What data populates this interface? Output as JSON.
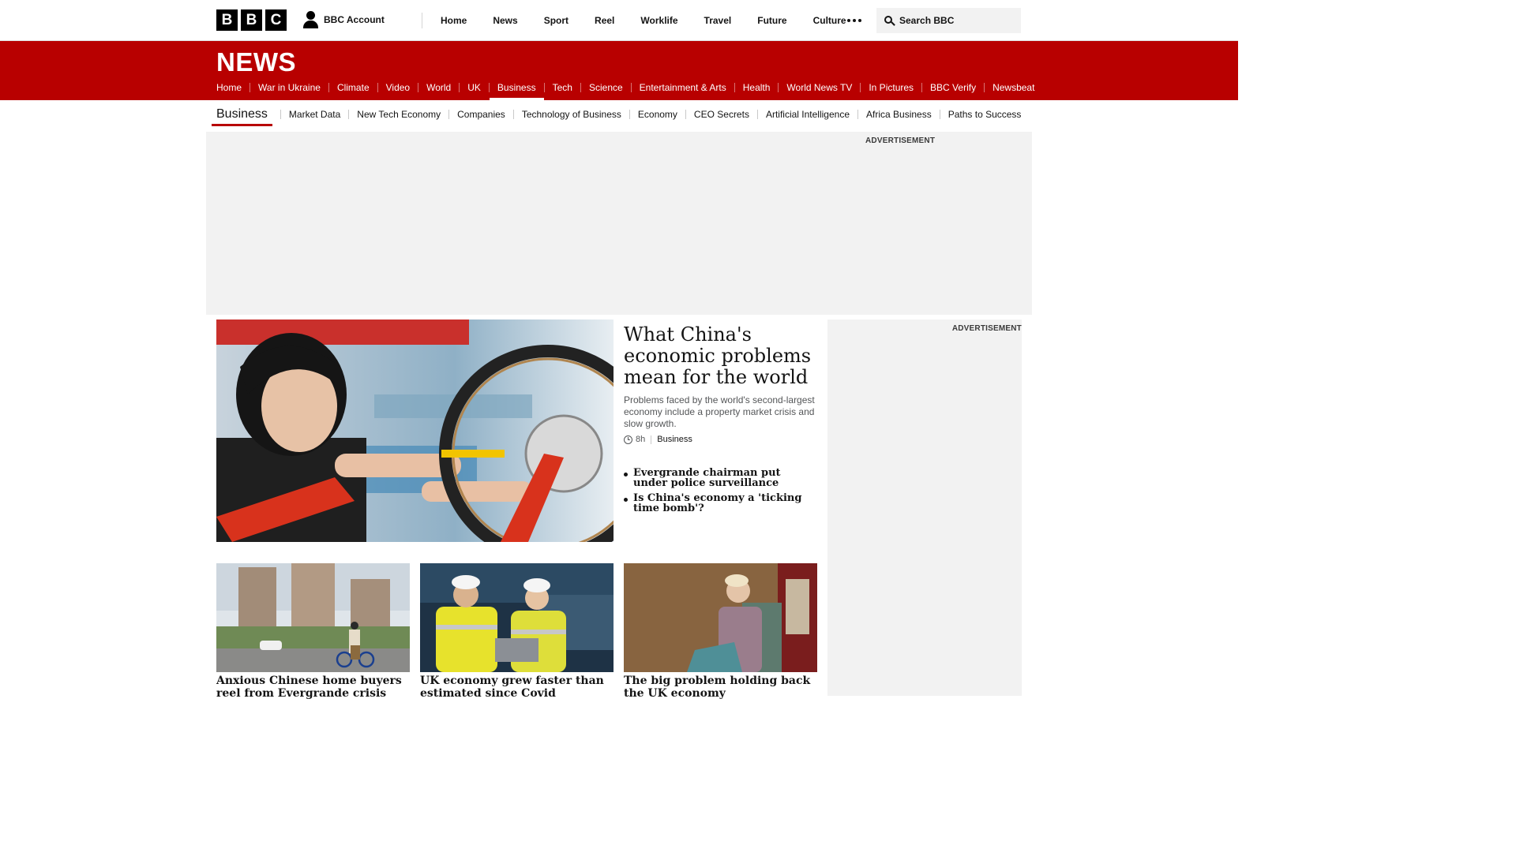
{
  "brand": {
    "letters": [
      "B",
      "B",
      "C"
    ]
  },
  "account": {
    "label": "BBC Account"
  },
  "top_nav": {
    "items": [
      "Home",
      "News",
      "Sport",
      "Reel",
      "Worklife",
      "Travel",
      "Future",
      "Culture"
    ]
  },
  "search": {
    "placeholder": "Search BBC"
  },
  "news_band": {
    "wordmark": "NEWS",
    "items": [
      "Home",
      "War in Ukraine",
      "Climate",
      "Video",
      "World",
      "UK",
      "Business",
      "Tech",
      "Science",
      "Entertainment & Arts",
      "Health",
      "World News TV",
      "In Pictures",
      "BBC Verify",
      "Newsbeat"
    ],
    "active": "Business"
  },
  "sub_nav": {
    "current": "Business",
    "items": [
      "Market Data",
      "New Tech Economy",
      "Companies",
      "Technology of Business",
      "Economy",
      "CEO Secrets",
      "Artificial Intelligence",
      "Africa Business",
      "Paths to Success"
    ]
  },
  "ads": {
    "top_label": "ADVERTISEMENT",
    "side_label": "ADVERTISEMENT"
  },
  "lead": {
    "title": "What China's economic problems mean for the world",
    "summary": "Problems faced by the world's second-largest economy include a property market crisis and slow growth.",
    "time": "8h",
    "topic": "Business",
    "related": [
      "Evergrande chairman put under police surveillance",
      "Is China's economy a 'ticking time bomb'?"
    ]
  },
  "cards": [
    {
      "title": "Anxious Chinese home buyers reel from Evergrande crisis"
    },
    {
      "title": "UK economy grew faster than estimated since Covid"
    },
    {
      "title": "The big problem holding back the UK economy"
    }
  ],
  "colors": {
    "brand_red": "#b80000",
    "ad_grey": "#f2f2f2",
    "text": "#141414",
    "meta": "#545658"
  },
  "icons": [
    "account-icon",
    "more-icon",
    "search-icon",
    "clock-icon"
  ]
}
